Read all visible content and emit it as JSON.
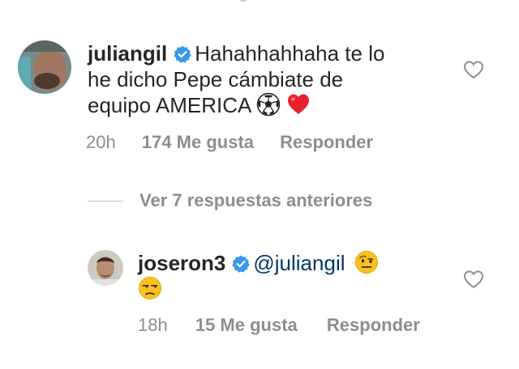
{
  "comments": [
    {
      "username": "juliangil",
      "verified": true,
      "text_lines": [
        "Hahahhahhaha te lo",
        "he dicho Pepe cámbiate de",
        "equipo AMERICA"
      ],
      "emojis": [
        "soccer-ball",
        "red-heart"
      ],
      "time": "20h",
      "likes": "174 Me gusta",
      "reply_label": "Responder"
    },
    {
      "username": "joseron3",
      "verified": true,
      "mention": "@juliangil",
      "emojis": [
        "raised-eyebrow-face",
        "unamused-face"
      ],
      "time": "18h",
      "likes": "15 Me gusta",
      "reply_label": "Responder"
    }
  ],
  "view_replies": "Ver 7 respuestas anteriores",
  "colors": {
    "verified_blue": "#3897f0",
    "muted": "#8e8e8e",
    "mention": "#00376b",
    "heart_red": "#e0245e"
  }
}
